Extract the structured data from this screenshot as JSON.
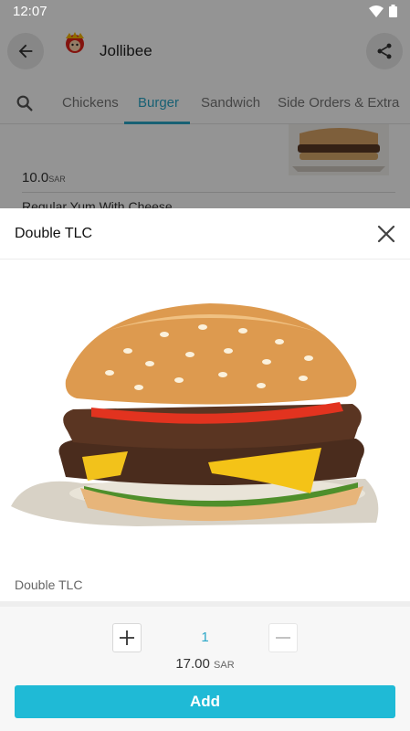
{
  "status_bar": {
    "time": "12:07"
  },
  "app_bar": {
    "title": "Jollibee",
    "logo_text": "Jollibee"
  },
  "tabs": [
    {
      "label": "Chickens",
      "active": false
    },
    {
      "label": "Burger",
      "active": true
    },
    {
      "label": "Sandwich",
      "active": false
    },
    {
      "label": "Side Orders & Extra",
      "active": false
    }
  ],
  "background_item": {
    "price": "10.0",
    "currency": "SAR",
    "next_item_name": "Regular Yum With Cheese"
  },
  "sheet": {
    "title": "Double TLC",
    "description": "Double TLC",
    "quantity": "1",
    "total_price": "17.00",
    "currency": "SAR",
    "add_label": "Add"
  },
  "colors": {
    "accent": "#2aa7c8",
    "add_button": "#1fbad6"
  }
}
